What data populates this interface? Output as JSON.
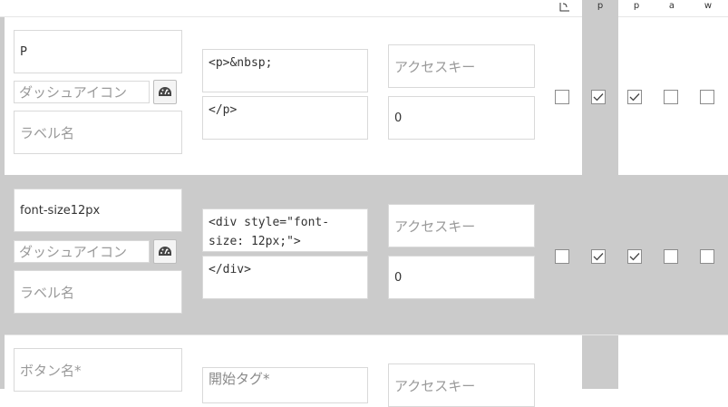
{
  "header": {
    "columns": [
      {
        "label": "p"
      },
      {
        "label": "p"
      },
      {
        "label": "a"
      },
      {
        "label": "w"
      }
    ]
  },
  "rows": [
    {
      "button_name": "P",
      "dashicon_placeholder": "ダッシュアイコン",
      "label_placeholder": "ラベル名",
      "start_tag": "<p>&nbsp;",
      "end_tag": "</p>",
      "accesskey_placeholder": "アクセスキー",
      "order": "0",
      "checks": [
        false,
        true,
        true,
        false,
        false
      ]
    },
    {
      "button_name": "font-size12px",
      "dashicon_placeholder": "ダッシュアイコン",
      "label_placeholder": "ラベル名",
      "start_tag": "<div style=\"font-size: 12px;\">",
      "end_tag": "</div>",
      "accesskey_placeholder": "アクセスキー",
      "order": "0",
      "checks": [
        false,
        true,
        true,
        false,
        false
      ]
    },
    {
      "button_name_placeholder": "ボタン名*",
      "start_tag_placeholder": "開始タグ*",
      "accesskey_placeholder": "アクセスキー"
    }
  ]
}
